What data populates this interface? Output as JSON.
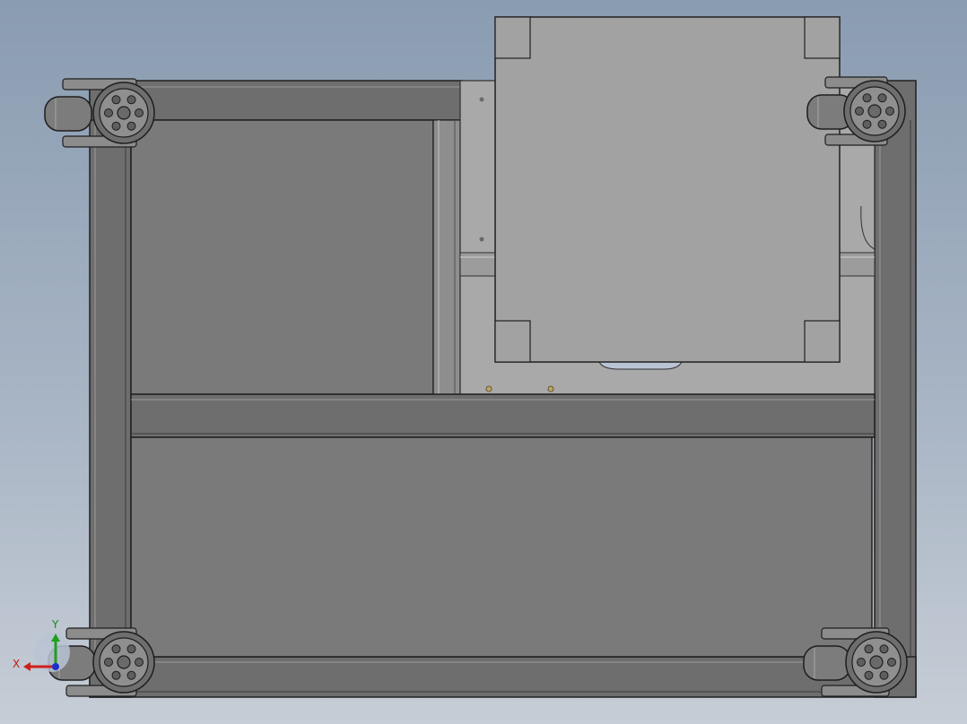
{
  "viewport": {
    "view": "cad-model-bottom-view",
    "background_colors": [
      "#8a9cb1",
      "#c6cdd6"
    ]
  },
  "model": {
    "frame_color": "#6e6e6e",
    "panel_color": "#7a7a7a",
    "plate_color": "#a3a3a3",
    "caster_count": 4
  },
  "triad": {
    "x_label": "X",
    "y_label": "Y",
    "x_color": "#d0201c",
    "y_color": "#1ea01e",
    "z_color": "#1c2fd0"
  }
}
